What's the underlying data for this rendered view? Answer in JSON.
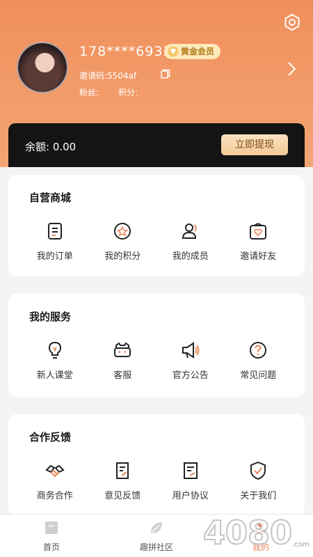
{
  "profile": {
    "phone": "178****6933",
    "vip_label": "黄金会员",
    "invite_code": "邀请码:5504af",
    "fans_label": "粉丝:",
    "points_label": "积分:"
  },
  "balance": {
    "text": "余额: 0.00",
    "withdraw_label": "立即提现"
  },
  "sections": [
    {
      "title": "自营商城",
      "items": [
        {
          "label": "我的订单",
          "icon": "order-icon"
        },
        {
          "label": "我的积分",
          "icon": "points-icon"
        },
        {
          "label": "我的成员",
          "icon": "members-icon"
        },
        {
          "label": "邀请好友",
          "icon": "invite-friend-icon"
        }
      ]
    },
    {
      "title": "我的服务",
      "items": [
        {
          "label": "新人课堂",
          "icon": "lightbulb-icon"
        },
        {
          "label": "客服",
          "icon": "customer-service-icon"
        },
        {
          "label": "官方公告",
          "icon": "megaphone-icon"
        },
        {
          "label": "常见问题",
          "icon": "question-icon"
        }
      ]
    },
    {
      "title": "合作反馈",
      "items": [
        {
          "label": "商务合作",
          "icon": "handshake-icon"
        },
        {
          "label": "意见反馈",
          "icon": "feedback-icon"
        },
        {
          "label": "用户协议",
          "icon": "agreement-icon"
        },
        {
          "label": "关于我们",
          "icon": "shield-check-icon"
        }
      ]
    }
  ],
  "tabbar": [
    {
      "label": "首页",
      "icon": "home-bag-icon"
    },
    {
      "label": "趣拼社区",
      "icon": "community-leaf-icon"
    },
    {
      "label": "我的",
      "icon": "profile-icon",
      "active": true
    }
  ],
  "colors": {
    "accent": "#f08f5b",
    "gold": "#f2c994",
    "card": "#141414"
  },
  "watermark": "4080"
}
